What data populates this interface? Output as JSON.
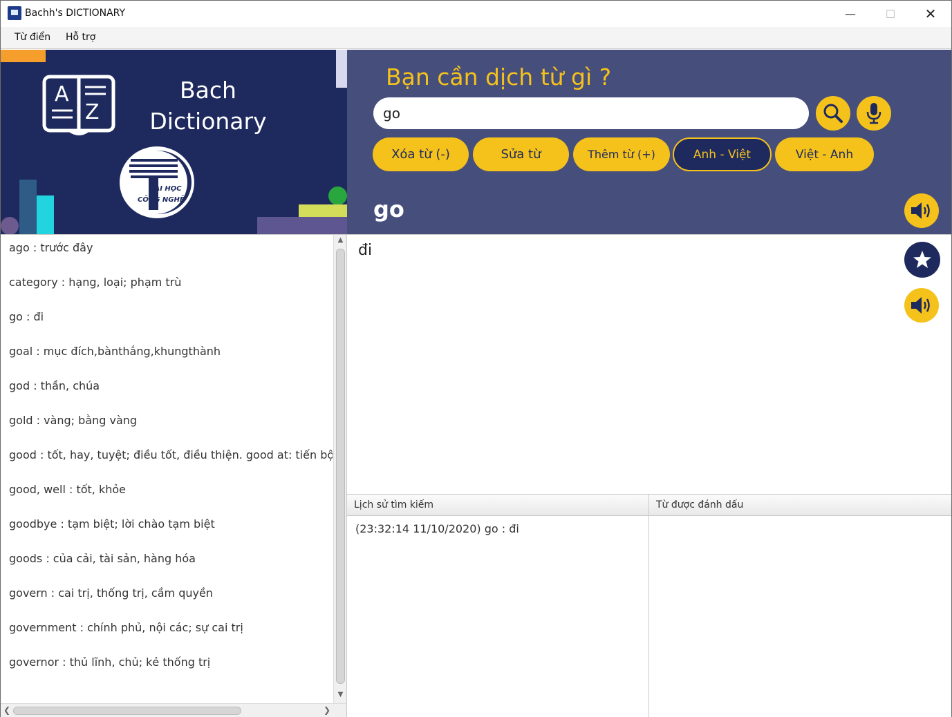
{
  "window": {
    "title": "Bachh's DICTIONARY",
    "minimize": "—",
    "maximize": "☐",
    "close": "✕"
  },
  "menu": {
    "items": [
      "Từ điển",
      "Hỗ trợ"
    ]
  },
  "banner": {
    "title_line1": "Bach",
    "title_line2": "Dictionary",
    "logo_text_1": "ĐẠI HỌC",
    "logo_text_2": "CÔNG NGHỆ",
    "book_letters": [
      "A",
      "Z"
    ]
  },
  "header": {
    "prompt": "Bạn cần dịch từ gì ?",
    "search_value": "go",
    "buttons": {
      "delete": "Xóa từ (-)",
      "edit": "Sửa từ",
      "add": "Thêm từ (+)",
      "en_vi": "Anh - Việt",
      "vi_en": "Việt - Anh"
    },
    "current_word": "go"
  },
  "word_list": [
    "ago : trước đây",
    "category : hạng, loại; phạm trù",
    "go : đi",
    "goal : mục đích,bànthắng,khungthành",
    "god : thần, chúa",
    "gold : vàng; bằng vàng",
    "good : tốt, hay, tuyệt; điều tốt, điều thiện. good at: tiến bộ ở.",
    "good, well : tốt, khỏe",
    "goodbye : tạm biệt; lời chào tạm biệt",
    "goods : của cải, tài sản, hàng hóa",
    "govern : cai trị, thống trị, cầm quyền",
    "government :  chính phủ, nội các; sự cai trị",
    "governor : thủ lĩnh, chủ; kẻ thống trị"
  ],
  "meaning": {
    "text": "đi"
  },
  "history": {
    "title": "Lịch sử tìm kiếm",
    "entries": [
      "(23:32:14 11/10/2020) go : đi"
    ]
  },
  "bookmarks": {
    "title": "Từ được đánh dấu",
    "entries": []
  },
  "colors": {
    "accent_yellow": "#f5c21b",
    "navy": "#1e2a5e",
    "header_bg": "#464e7c"
  }
}
